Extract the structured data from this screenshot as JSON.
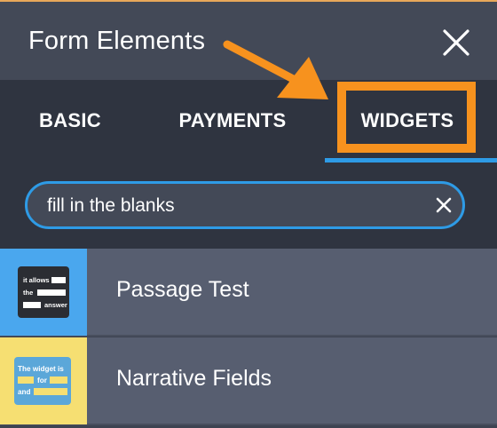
{
  "header": {
    "title": "Form Elements",
    "close_icon": "close-icon"
  },
  "tabs": [
    {
      "label": "BASIC",
      "active": false
    },
    {
      "label": "PAYMENTS",
      "active": false
    },
    {
      "label": "WIDGETS",
      "active": true
    }
  ],
  "search": {
    "value": "fill in the blanks",
    "clear_icon": "close-icon"
  },
  "results": [
    {
      "label": "Passage Test",
      "thumb_bg": "#4aa7ee",
      "thumb_lines": [
        "it allows",
        "the",
        "answer"
      ]
    },
    {
      "label": "Narrative Fields",
      "thumb_bg": "#f6df72",
      "thumb_lines": [
        "The widget is",
        "for",
        "and"
      ]
    }
  ],
  "colors": {
    "accent": "#2e9be6",
    "highlight": "#f7921e",
    "header_bg": "#434957",
    "tabs_bg": "#2f3440",
    "row_bg": "#575e70"
  }
}
